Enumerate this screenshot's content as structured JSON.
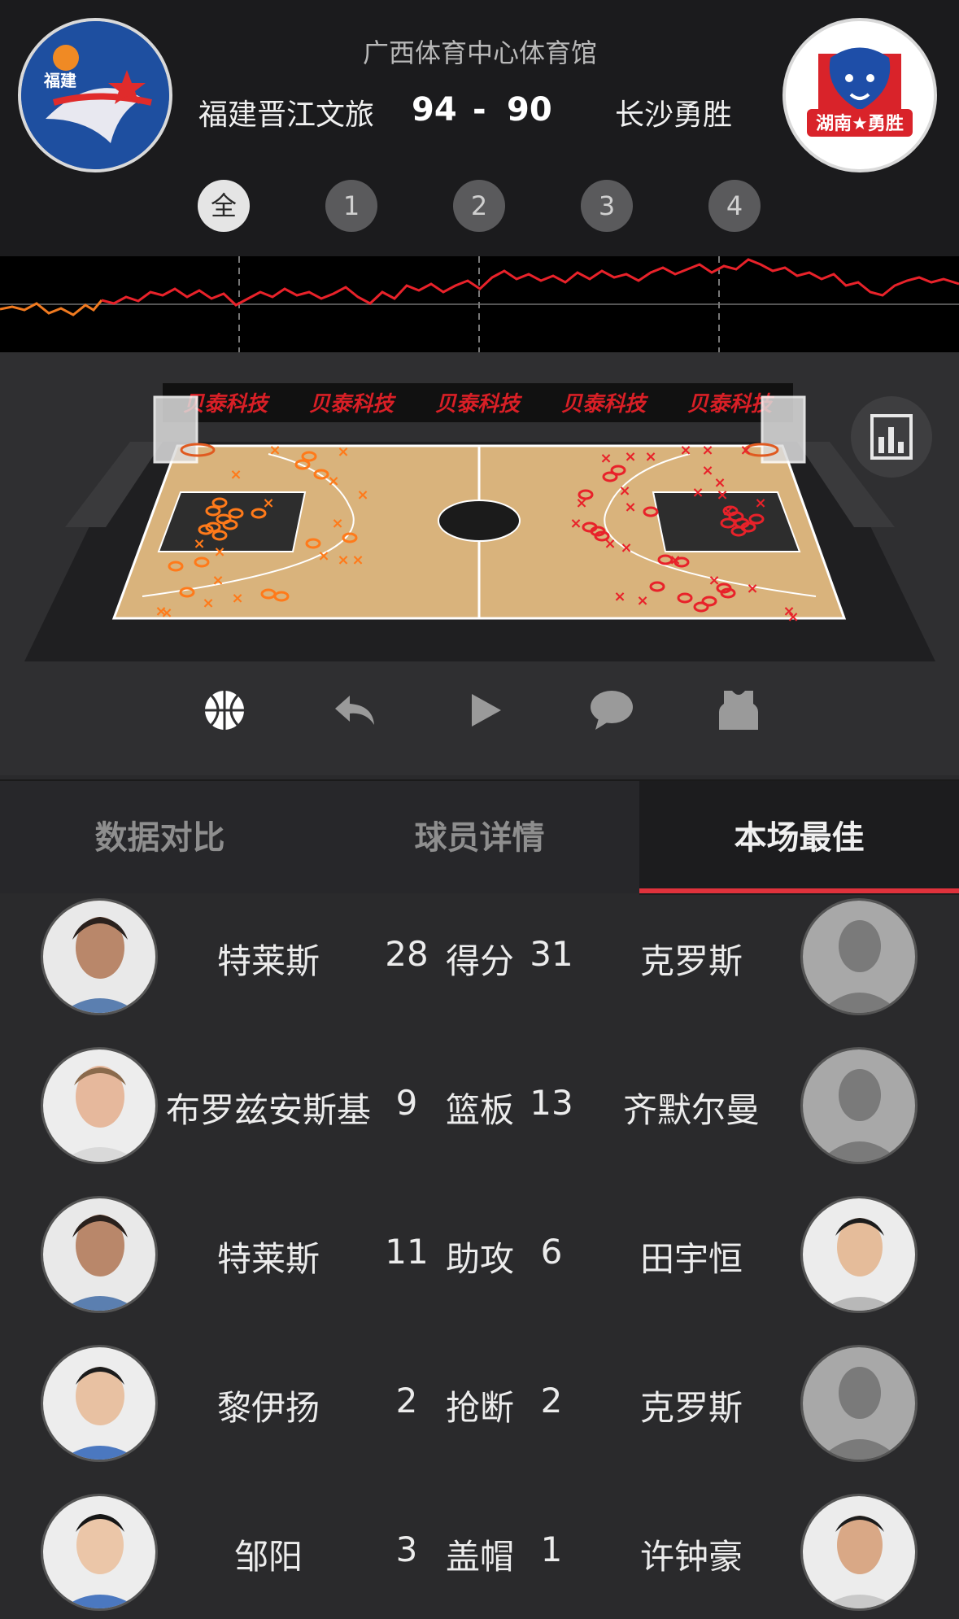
{
  "header": {
    "venue": "广西体育中心体育馆",
    "home_team": "福建晋江文旅",
    "away_team": "长沙勇胜",
    "home_score": "94",
    "separator": "-",
    "away_score": "90",
    "home_logo_text": "福建",
    "away_logo_text": "湖南★勇胜"
  },
  "periods": [
    {
      "label": "全",
      "active": true
    },
    {
      "label": "1",
      "active": false
    },
    {
      "label": "2",
      "active": false
    },
    {
      "label": "3",
      "active": false
    },
    {
      "label": "4",
      "active": false
    }
  ],
  "court": {
    "sponsor": [
      "贝泰科技",
      "贝泰科技",
      "贝泰科技",
      "贝泰科技",
      "贝泰科技"
    ],
    "home_color": "#ff7a1a",
    "away_color": "#e8222a"
  },
  "toolbar": {
    "icons": [
      "basketball-icon",
      "reply-icon",
      "play-icon",
      "chat-icon",
      "jersey-icon"
    ]
  },
  "tabs": [
    {
      "label": "数据对比",
      "active": false
    },
    {
      "label": "球员详情",
      "active": false
    },
    {
      "label": "本场最佳",
      "active": true
    }
  ],
  "best_players": [
    {
      "stat": "得分",
      "home_player": "特莱斯",
      "home_value": "28",
      "away_player": "克罗斯",
      "away_value": "31"
    },
    {
      "stat": "篮板",
      "home_player": "布罗兹安斯基",
      "home_value": "9",
      "away_player": "齐默尔曼",
      "away_value": "13"
    },
    {
      "stat": "助攻",
      "home_player": "特莱斯",
      "home_value": "11",
      "away_player": "田宇恒",
      "away_value": "6"
    },
    {
      "stat": "抢断",
      "home_player": "黎伊扬",
      "home_value": "2",
      "away_player": "克罗斯",
      "away_value": "2"
    },
    {
      "stat": "盖帽",
      "home_player": "邹阳",
      "home_value": "3",
      "away_player": "许钟豪",
      "away_value": "1"
    }
  ]
}
